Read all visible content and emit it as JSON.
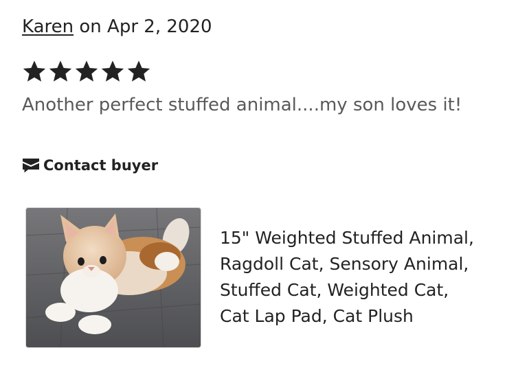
{
  "review": {
    "reviewer_name": "Karen",
    "date_text": "on Apr 2, 2020",
    "rating": 5,
    "rating_max": 5,
    "text": "Another perfect stuffed animal....my son loves it!",
    "contact_label": "Contact buyer",
    "contact_icon": "message-icon",
    "star_icon": "star-icon"
  },
  "product": {
    "title_lines": [
      "15\" Weighted Stuffed Animal,",
      "Ragdoll Cat, Sensory Animal,",
      "Stuffed Cat, Weighted Cat,",
      "Cat Lap Pad, Cat Plush"
    ],
    "image_icon": "product-image"
  },
  "colors": {
    "text": "#222222",
    "secondary_text": "#595959",
    "star": "#222222"
  }
}
